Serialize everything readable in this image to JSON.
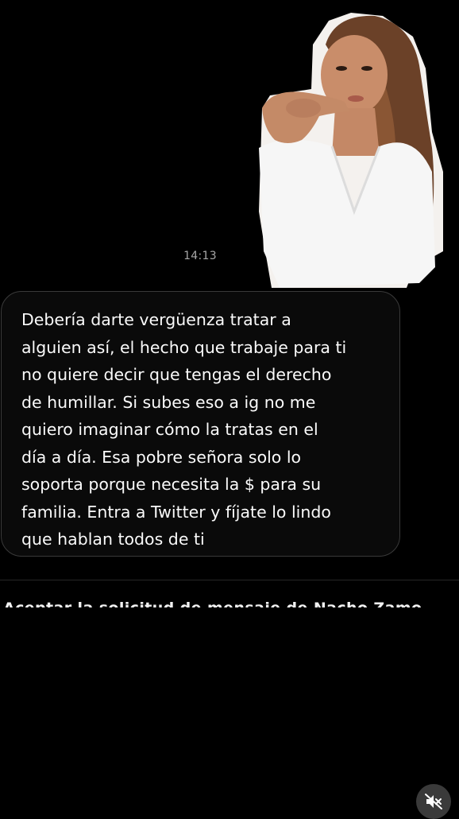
{
  "conversation": {
    "timestamp": "14:13",
    "message": "Debería darte vergüenza tratar a\nalguien así, el hecho que trabaje para ti\nno quiere decir que tengas el derecho\nde humillar. Si subes eso a ig no me\nquiero imaginar cómo la tratas en el\ndía a día. Esa pobre señora solo lo\nsoporta porque necesita la $ para su\nfamilia. Entra a Twitter y fíjate lo lindo\nque hablan todos de ti"
  },
  "request_bar": {
    "label": "Aceptar la solicitud de mensaje de Nacho Zamo"
  },
  "video_controls": {
    "mute_icon": "speaker-muted-icon"
  },
  "colors": {
    "background": "#000000",
    "bubble_border": "#3a3a3a",
    "timestamp": "#a8a8a8"
  }
}
